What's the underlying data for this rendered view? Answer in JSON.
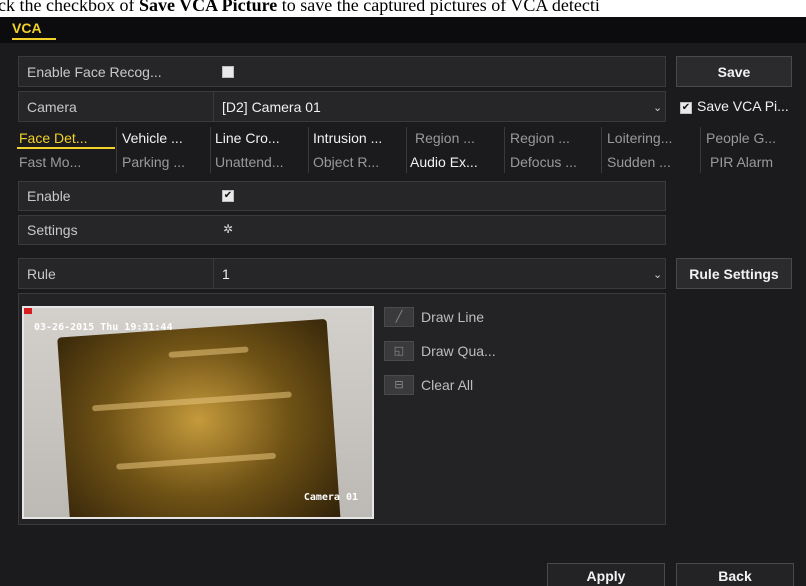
{
  "caption": {
    "prefix": "ck the checkbox of ",
    "bold": "Save VCA Picture",
    "suffix": " to save the captured pictures of VCA detecti"
  },
  "window": {
    "title": "VCA",
    "accent": "#f2d22a"
  },
  "enable_face_recognition": {
    "label": "Enable Face Recog...",
    "checked": false
  },
  "save_button": "Save",
  "camera": {
    "label": "Camera",
    "value": "[D2] Camera 01"
  },
  "save_vca_picture": {
    "label": "Save VCA Pi...",
    "checked": true
  },
  "tabs_row1": [
    "Face Det...",
    "Vehicle ...",
    "Line Cro...",
    "Intrusion ...",
    "Region ...",
    "Region ...",
    "Loitering...",
    "People G..."
  ],
  "tabs_row2": [
    "Fast Mo...",
    "Parking ...",
    "Unattend...",
    "Object R...",
    "Audio Ex...",
    "Defocus ...",
    "Sudden ...",
    "PIR Alarm"
  ],
  "active_tab": "Face Det...",
  "enable": {
    "label": "Enable",
    "checked": true,
    "mark": "✔"
  },
  "settings": {
    "label": "Settings",
    "icon": "gear-icon",
    "glyph": "✲"
  },
  "rule": {
    "label": "Rule",
    "value": "1"
  },
  "rule_settings_button": "Rule Settings",
  "preview": {
    "timestamp": "03-26-2015 Thu 19:31:44",
    "camera_name": "Camera 01"
  },
  "tools": {
    "draw_line": {
      "label": "Draw Line",
      "icon": "draw-line-icon",
      "glyph": "╱"
    },
    "draw_quad": {
      "label": "Draw Qua...",
      "icon": "draw-quad-icon",
      "glyph": "◱"
    },
    "clear_all": {
      "label": "Clear All",
      "icon": "clear-all-icon",
      "glyph": "⊟"
    }
  },
  "apply_button": "Apply",
  "back_button": "Back"
}
